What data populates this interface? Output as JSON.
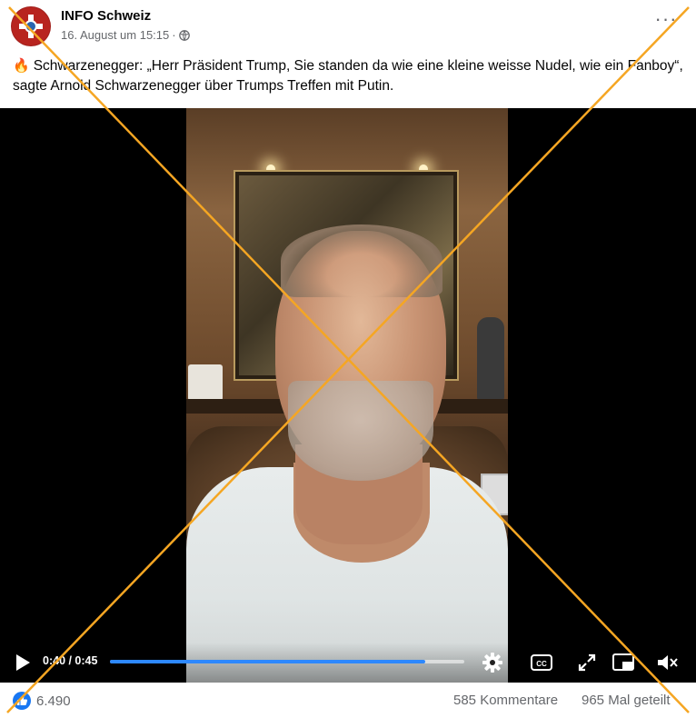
{
  "post": {
    "page_name": "INFO Schweiz",
    "date": "16. August um 15:15",
    "separator": "·",
    "text": "Schwarzenegger: „Herr Präsident Trump, Sie standen da wie eine kleine weisse Nudel, wie ein Fanboy“, sagte Arnold Schwarzenegger über Trumps Treffen mit Putin.",
    "emoji": "🔥",
    "more_label": "···"
  },
  "video": {
    "time": "0:40 / 0:45",
    "progress": 0.889
  },
  "footer": {
    "likes": "6.490",
    "comments": "585 Kommentare",
    "shares": "965 Mal geteilt"
  },
  "colors": {
    "accent": "#2d88ff",
    "like": "#1877f2",
    "overlay_cross": "#f5a623"
  },
  "icons": [
    "globe-icon",
    "fire-icon",
    "play-icon",
    "settings-icon",
    "captions-icon",
    "fullscreen-icon",
    "pip-icon",
    "mute-icon",
    "like-icon"
  ]
}
